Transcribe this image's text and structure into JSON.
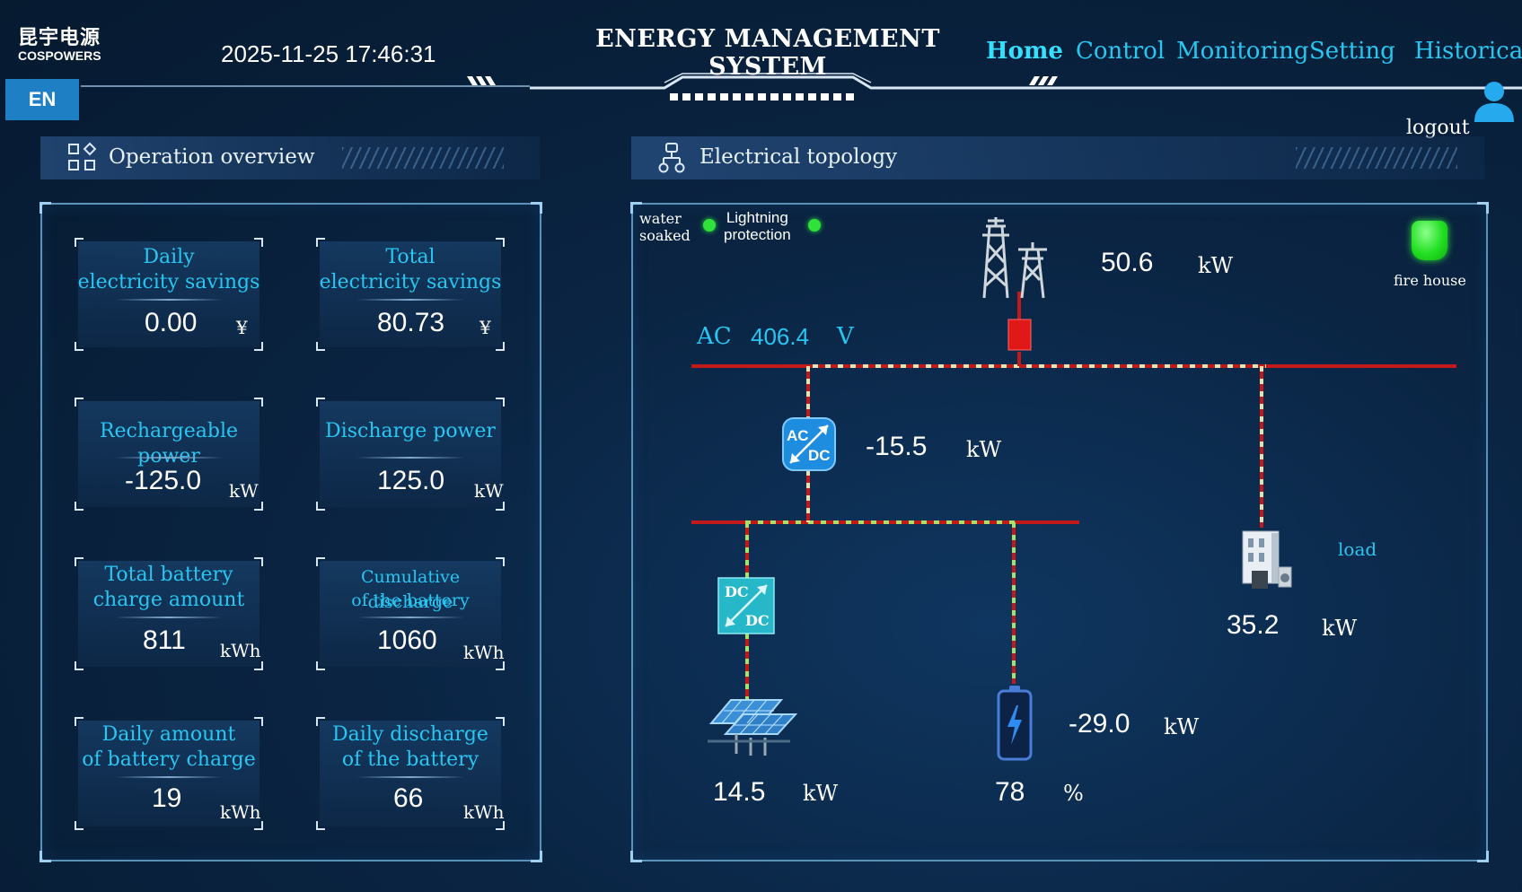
{
  "header": {
    "logo_cn": "昆宇电源",
    "logo_en": "COSPOWERS",
    "datetime": "2025-11-25 17:46:31",
    "language": "EN",
    "system_title": "ENERGY MANAGEMENT SYSTEM",
    "nav": [
      "Home",
      "Control",
      "Monitoring",
      "Setting",
      "Historical"
    ],
    "active_nav": "Home",
    "logout": "logout"
  },
  "overview": {
    "title": "Operation overview",
    "cards": [
      {
        "label": [
          "Daily",
          "electricity savings"
        ],
        "value": "0.00",
        "unit": "¥"
      },
      {
        "label": [
          "Total",
          "electricity savings"
        ],
        "value": "80.73",
        "unit": "¥"
      },
      {
        "label": [
          "Rechargeable power"
        ],
        "value": "-125.0",
        "unit": "kW"
      },
      {
        "label": [
          "Discharge power"
        ],
        "value": "125.0",
        "unit": "kW"
      },
      {
        "label": [
          "Total battery",
          "charge amount"
        ],
        "value": "811",
        "unit": "kWh"
      },
      {
        "label": [
          "Cumulative discharge",
          "of the battery"
        ],
        "value": "1060",
        "unit": "kWh"
      },
      {
        "label": [
          "Daily amount",
          "of battery charge"
        ],
        "value": "19",
        "unit": "kWh"
      },
      {
        "label": [
          "Daily discharge",
          "of the battery"
        ],
        "value": "66",
        "unit": "kWh"
      }
    ]
  },
  "topology": {
    "title": "Electrical topology",
    "water_soaked": [
      "water",
      "soaked"
    ],
    "lightning": [
      "Lightning",
      "protection"
    ],
    "fire_house": "fire house",
    "grid": {
      "value": "50.6",
      "unit": "kW"
    },
    "ac_bus": {
      "prefix": "AC",
      "value": "406.4",
      "unit": "V"
    },
    "pcs": {
      "value": "-15.5",
      "unit": "kW",
      "icon_top": "AC",
      "icon_bottom": "DC"
    },
    "dcdc": {
      "icon_top": "DC",
      "icon_bottom": "DC"
    },
    "pv": {
      "value": "14.5",
      "unit": "kW"
    },
    "battery": {
      "value": "-29.0",
      "unit": "kW",
      "soc": "78",
      "soc_unit": "%"
    },
    "load": {
      "label": "load",
      "value": "35.2",
      "unit": "kW"
    },
    "status_colors": {
      "ok": "#2ee23a",
      "breaker": "#e01818",
      "bus": "#c21a1a"
    }
  }
}
